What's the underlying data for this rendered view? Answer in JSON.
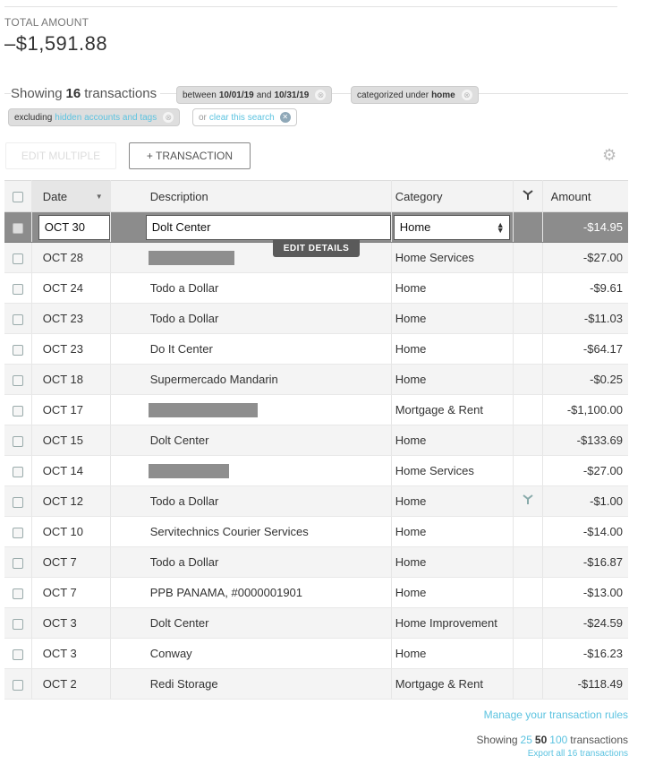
{
  "summary": {
    "total_label": "TOTAL AMOUNT",
    "total_amount": "–$1,591.88"
  },
  "filters": {
    "showing_prefix": "Showing",
    "count": "16",
    "showing_suffix": "transactions",
    "date_chip": {
      "prefix": "between",
      "start": "10/01/19",
      "mid": "and",
      "end": "10/31/19"
    },
    "category_chip": {
      "prefix": "categorized under",
      "value": "home"
    },
    "exclude_chip": {
      "prefix": "excluding",
      "link": "hidden accounts and tags"
    },
    "clear_chip": {
      "prefix": "or",
      "link": "clear this search"
    },
    "chip_close_glyph": "⊗"
  },
  "toolbar": {
    "edit_multiple_label": "EDIT MULTIPLE",
    "add_transaction_label": "+ TRANSACTION",
    "settings_icon": "gear-icon"
  },
  "table": {
    "columns": {
      "date": "Date",
      "description": "Description",
      "category": "Category",
      "tags": "tag-icon",
      "amount": "Amount"
    },
    "editing_row": {
      "date": "OCT 30",
      "description": "Dolt Center",
      "category": "Home",
      "amount": "-$14.95",
      "edit_details_label": "EDIT DETAILS"
    },
    "rows": [
      {
        "date": "OCT 28",
        "description": "",
        "redacted": true,
        "category": "Home Services",
        "tag": false,
        "amount": "-$27.00"
      },
      {
        "date": "OCT 24",
        "description": "Todo a Dollar",
        "redacted": false,
        "category": "Home",
        "tag": false,
        "amount": "-$9.61"
      },
      {
        "date": "OCT 23",
        "description": "Todo a Dollar",
        "redacted": false,
        "category": "Home",
        "tag": false,
        "amount": "-$11.03"
      },
      {
        "date": "OCT 23",
        "description": "Do It Center",
        "redacted": false,
        "category": "Home",
        "tag": false,
        "amount": "-$64.17"
      },
      {
        "date": "OCT 18",
        "description": "Supermercado Mandarin",
        "redacted": false,
        "category": "Home",
        "tag": false,
        "amount": "-$0.25"
      },
      {
        "date": "OCT 17",
        "description": "",
        "redacted": true,
        "category": "Mortgage & Rent",
        "tag": false,
        "amount": "-$1,100.00"
      },
      {
        "date": "OCT 15",
        "description": "Dolt Center",
        "redacted": false,
        "category": "Home",
        "tag": false,
        "amount": "-$133.69"
      },
      {
        "date": "OCT 14",
        "description": "",
        "redacted": true,
        "category": "Home Services",
        "tag": false,
        "amount": "-$27.00"
      },
      {
        "date": "OCT 12",
        "description": "Todo a Dollar",
        "redacted": false,
        "category": "Home",
        "tag": true,
        "amount": "-$1.00"
      },
      {
        "date": "OCT 10",
        "description": "Servitechnics Courier Services",
        "redacted": false,
        "category": "Home",
        "tag": false,
        "amount": "-$14.00"
      },
      {
        "date": "OCT 7",
        "description": "Todo a Dollar",
        "redacted": false,
        "category": "Home",
        "tag": false,
        "amount": "-$16.87"
      },
      {
        "date": "OCT 7",
        "description": "PPB PANAMA, #0000001901",
        "redacted": false,
        "category": "Home",
        "tag": false,
        "amount": "-$13.00"
      },
      {
        "date": "OCT 3",
        "description": "Dolt Center",
        "redacted": false,
        "category": "Home Improvement",
        "tag": false,
        "amount": "-$24.59"
      },
      {
        "date": "OCT 3",
        "description": "Conway",
        "redacted": false,
        "category": "Home",
        "tag": false,
        "amount": "-$16.23"
      },
      {
        "date": "OCT 2",
        "description": "Redi Storage",
        "redacted": false,
        "category": "Mortgage & Rent",
        "tag": false,
        "amount": "-$118.49"
      }
    ]
  },
  "footer": {
    "manage_rules": "Manage your transaction rules",
    "showing_label": "Showing",
    "page_sizes": [
      "25",
      "50",
      "100"
    ],
    "selected_page_size": "50",
    "transactions_label": "transactions",
    "export_label": "Export all 16 transactions"
  },
  "colors": {
    "link": "#5cc3e0",
    "selected_row": "#8c8c8c",
    "redaction": "#8e8e8e"
  }
}
